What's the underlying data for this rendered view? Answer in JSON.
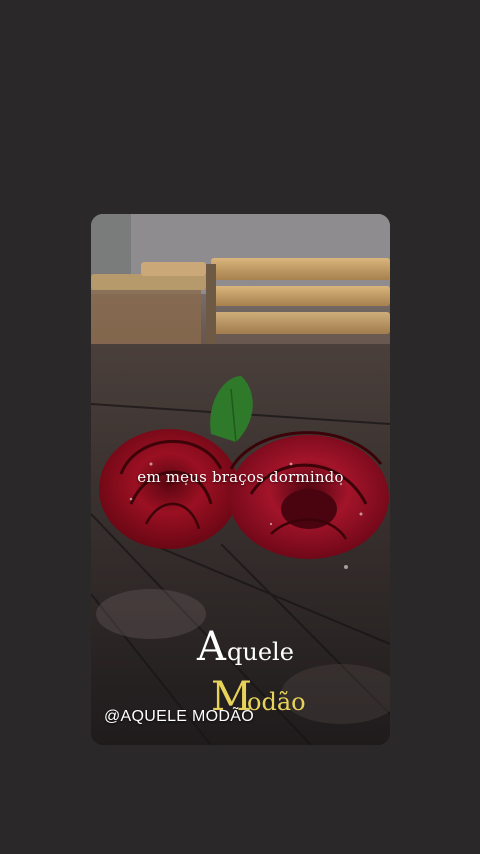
{
  "story": {
    "caption": "em meus braços dormindo",
    "logo": {
      "line1": "Aquele",
      "line2": "Modão",
      "line1_color": "#ffffff",
      "line2_color": "#e8d35a"
    },
    "handle": "@AQUELE MODÃO"
  },
  "colors": {
    "background": "#2a2828",
    "rose": "#8f0f1c",
    "leaf": "#2f7a2a",
    "wood": "#c9a26c"
  }
}
